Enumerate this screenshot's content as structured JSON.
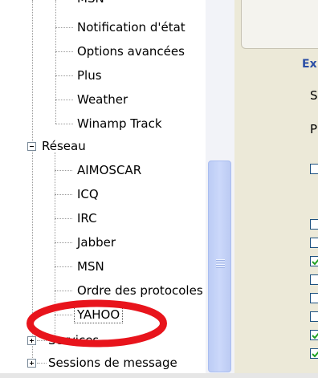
{
  "tree": {
    "top_cut_label": "MSN",
    "items_top": [
      "Notification d'état",
      "Options avancées",
      "Plus",
      "Weather",
      "Winamp Track"
    ],
    "group_reseau": "Réseau",
    "items_reseau": [
      "AIMOSCAR",
      "ICQ",
      "IRC",
      "Jabber",
      "MSN",
      "Ordre des protocoles",
      "YAHOO"
    ],
    "group_services": "Services",
    "group_sessions": "Sessions de message"
  },
  "panel": {
    "heading": "Ex",
    "label_s": "S",
    "label_p": "P",
    "checkboxes": [
      false,
      false,
      false,
      true,
      false,
      false,
      true,
      true
    ]
  },
  "colors": {
    "highlight_ellipse": "#e8141c",
    "check": "#21a121",
    "panel_bg": "#ece9d8",
    "heading": "#2a4ea5"
  },
  "icons": {
    "expand": "plus-box-icon",
    "collapse": "minus-box-icon",
    "check": "checkmark-icon"
  }
}
